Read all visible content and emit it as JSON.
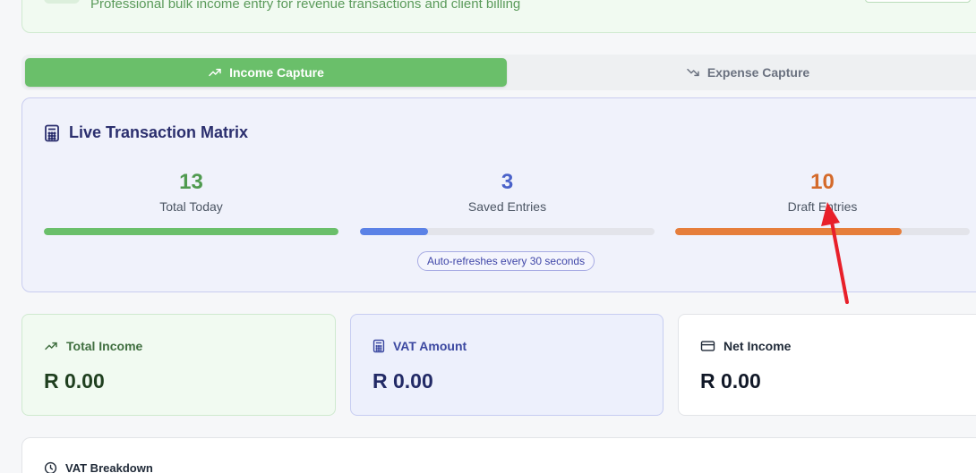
{
  "header": {
    "subtitle": "Professional bulk income entry for revenue transactions and client billing"
  },
  "tabs": [
    {
      "label": "Income Capture",
      "icon": "trending-up-icon",
      "active": true
    },
    {
      "label": "Expense Capture",
      "icon": "trending-down-icon",
      "active": false
    }
  ],
  "matrix": {
    "title": "Live Transaction Matrix",
    "icon": "calculator-icon",
    "stats": [
      {
        "value": "13",
        "label": "Total Today",
        "color": "#4f9a4f",
        "bar_color": "#6abf6a",
        "progress": 1.0
      },
      {
        "value": "3",
        "label": "Saved Entries",
        "color": "#4a62c9",
        "bar_color": "#5b82e6",
        "progress": 0.23
      },
      {
        "value": "10",
        "label": "Draft Entries",
        "color": "#d46a2a",
        "bar_color": "#e67e3b",
        "progress": 0.77
      }
    ],
    "refresh_note": "Auto-refreshes every 30 seconds"
  },
  "summary": {
    "total_income": {
      "label": "Total Income",
      "value": "R 0.00",
      "icon": "trending-up-icon"
    },
    "vat_amount": {
      "label": "VAT Amount",
      "value": "R 0.00",
      "icon": "calculator-icon"
    },
    "net_income": {
      "label": "Net Income",
      "value": "R 0.00",
      "icon": "credit-card-icon"
    }
  },
  "vat_breakdown": {
    "label": "VAT Breakdown",
    "icon": "clock-icon"
  },
  "annotation": {
    "color": "#e8202a"
  }
}
